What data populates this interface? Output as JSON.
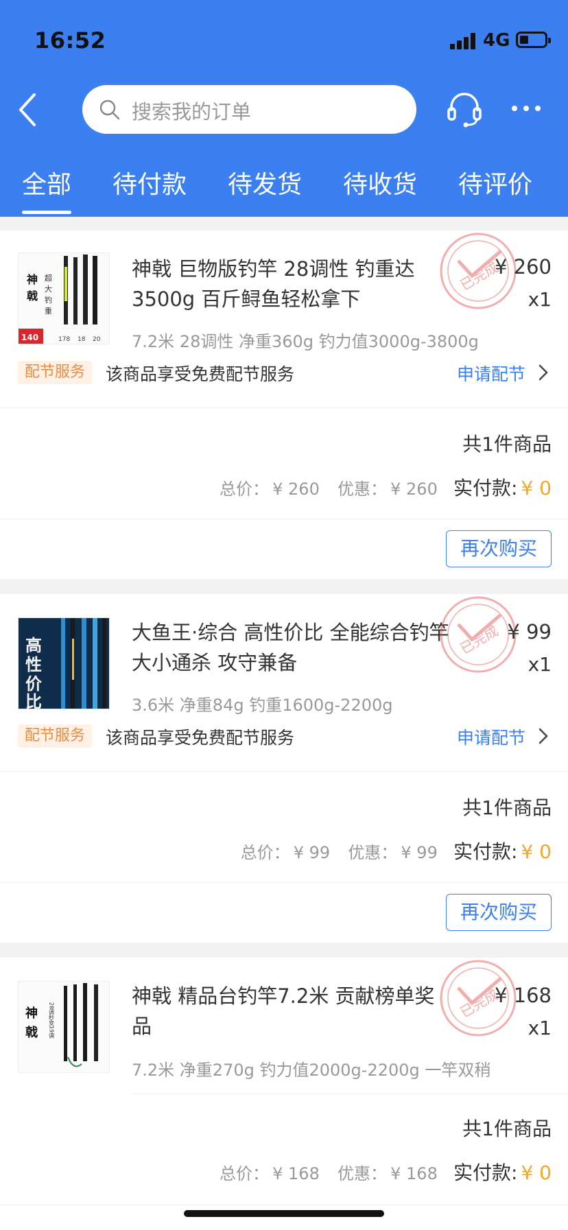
{
  "status_bar": {
    "time": "16:52",
    "network": "4G"
  },
  "header": {
    "search_placeholder": "搜索我的订单",
    "back_icon": "chevron-left-icon",
    "service_icon": "headset-icon",
    "more_icon": "more-dots-icon"
  },
  "tabs": [
    {
      "label": "全部",
      "active": true
    },
    {
      "label": "待付款",
      "active": false
    },
    {
      "label": "待发货",
      "active": false
    },
    {
      "label": "待收货",
      "active": false
    },
    {
      "label": "待评价",
      "active": false
    }
  ],
  "orders": [
    {
      "title": "神戟 巨物版钓竿 28调性 钓重达3500g 百斤鲟鱼轻松拿下",
      "price": "¥ 260",
      "qty": "x1",
      "spec": "7.2米 28调性 净重360g 钓力值3000g-3800g",
      "stamp": "已完成",
      "service_badge": "配节服务",
      "service_text": "该商品享受免费配节服务",
      "service_link": "申请配节",
      "count": "共1件商品",
      "total_label": "总价：",
      "total": "¥ 260",
      "discount_label": "优惠：",
      "discount": "¥ 260",
      "pay_label": "实付款:",
      "pay": "¥ 0",
      "rebuy": "再次购买",
      "thumb_text": [
        "神",
        "戟",
        "超",
        "大",
        "钓",
        "重",
        "140",
        "178",
        "18",
        "20"
      ]
    },
    {
      "title": "大鱼王·综合 高性价比 全能综合钓竿 大小通杀 攻守兼备",
      "price": "¥ 99",
      "qty": "x1",
      "spec": "3.6米 净重84g 钓重1600g-2200g",
      "stamp": "已完成",
      "service_badge": "配节服务",
      "service_text": "该商品享受免费配节服务",
      "service_link": "申请配节",
      "count": "共1件商品",
      "total_label": "总价：",
      "total": "¥ 99",
      "discount_label": "优惠：",
      "discount": "¥ 99",
      "pay_label": "实付款:",
      "pay": "¥ 0",
      "rebuy": "再次购买",
      "thumb_text": [
        "高",
        "性",
        "价",
        "比"
      ]
    },
    {
      "title": "神戟 精品台钓竿7.2米 贡献榜单奖品",
      "price": "¥ 168",
      "qty": "x1",
      "spec": "7.2米 净重270g 钓力值2000g-2200g  一竿双稍",
      "stamp": "已完成",
      "count": "共1件商品",
      "total_label": "总价：",
      "total": "¥ 168",
      "discount_label": "优惠：",
      "discount": "¥ 168",
      "pay_label": "实付款:",
      "pay": "¥ 0",
      "thumb_text": [
        "神",
        "戟",
        "28调秒变19调"
      ]
    }
  ],
  "colors": {
    "header_blue": "#3b7ff0",
    "accent_orange": "#f5a623",
    "stamp_red": "#e24a4a",
    "badge_orange": "#f08a3c"
  }
}
